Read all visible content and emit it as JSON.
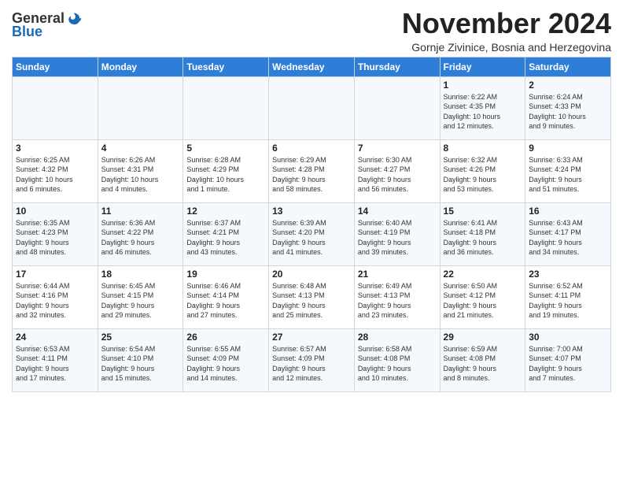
{
  "header": {
    "logo_general": "General",
    "logo_blue": "Blue",
    "month_title": "November 2024",
    "subtitle": "Gornje Zivinice, Bosnia and Herzegovina"
  },
  "weekdays": [
    "Sunday",
    "Monday",
    "Tuesday",
    "Wednesday",
    "Thursday",
    "Friday",
    "Saturday"
  ],
  "weeks": [
    [
      {
        "day": "",
        "info": ""
      },
      {
        "day": "",
        "info": ""
      },
      {
        "day": "",
        "info": ""
      },
      {
        "day": "",
        "info": ""
      },
      {
        "day": "",
        "info": ""
      },
      {
        "day": "1",
        "info": "Sunrise: 6:22 AM\nSunset: 4:35 PM\nDaylight: 10 hours\nand 12 minutes."
      },
      {
        "day": "2",
        "info": "Sunrise: 6:24 AM\nSunset: 4:33 PM\nDaylight: 10 hours\nand 9 minutes."
      }
    ],
    [
      {
        "day": "3",
        "info": "Sunrise: 6:25 AM\nSunset: 4:32 PM\nDaylight: 10 hours\nand 6 minutes."
      },
      {
        "day": "4",
        "info": "Sunrise: 6:26 AM\nSunset: 4:31 PM\nDaylight: 10 hours\nand 4 minutes."
      },
      {
        "day": "5",
        "info": "Sunrise: 6:28 AM\nSunset: 4:29 PM\nDaylight: 10 hours\nand 1 minute."
      },
      {
        "day": "6",
        "info": "Sunrise: 6:29 AM\nSunset: 4:28 PM\nDaylight: 9 hours\nand 58 minutes."
      },
      {
        "day": "7",
        "info": "Sunrise: 6:30 AM\nSunset: 4:27 PM\nDaylight: 9 hours\nand 56 minutes."
      },
      {
        "day": "8",
        "info": "Sunrise: 6:32 AM\nSunset: 4:26 PM\nDaylight: 9 hours\nand 53 minutes."
      },
      {
        "day": "9",
        "info": "Sunrise: 6:33 AM\nSunset: 4:24 PM\nDaylight: 9 hours\nand 51 minutes."
      }
    ],
    [
      {
        "day": "10",
        "info": "Sunrise: 6:35 AM\nSunset: 4:23 PM\nDaylight: 9 hours\nand 48 minutes."
      },
      {
        "day": "11",
        "info": "Sunrise: 6:36 AM\nSunset: 4:22 PM\nDaylight: 9 hours\nand 46 minutes."
      },
      {
        "day": "12",
        "info": "Sunrise: 6:37 AM\nSunset: 4:21 PM\nDaylight: 9 hours\nand 43 minutes."
      },
      {
        "day": "13",
        "info": "Sunrise: 6:39 AM\nSunset: 4:20 PM\nDaylight: 9 hours\nand 41 minutes."
      },
      {
        "day": "14",
        "info": "Sunrise: 6:40 AM\nSunset: 4:19 PM\nDaylight: 9 hours\nand 39 minutes."
      },
      {
        "day": "15",
        "info": "Sunrise: 6:41 AM\nSunset: 4:18 PM\nDaylight: 9 hours\nand 36 minutes."
      },
      {
        "day": "16",
        "info": "Sunrise: 6:43 AM\nSunset: 4:17 PM\nDaylight: 9 hours\nand 34 minutes."
      }
    ],
    [
      {
        "day": "17",
        "info": "Sunrise: 6:44 AM\nSunset: 4:16 PM\nDaylight: 9 hours\nand 32 minutes."
      },
      {
        "day": "18",
        "info": "Sunrise: 6:45 AM\nSunset: 4:15 PM\nDaylight: 9 hours\nand 29 minutes."
      },
      {
        "day": "19",
        "info": "Sunrise: 6:46 AM\nSunset: 4:14 PM\nDaylight: 9 hours\nand 27 minutes."
      },
      {
        "day": "20",
        "info": "Sunrise: 6:48 AM\nSunset: 4:13 PM\nDaylight: 9 hours\nand 25 minutes."
      },
      {
        "day": "21",
        "info": "Sunrise: 6:49 AM\nSunset: 4:13 PM\nDaylight: 9 hours\nand 23 minutes."
      },
      {
        "day": "22",
        "info": "Sunrise: 6:50 AM\nSunset: 4:12 PM\nDaylight: 9 hours\nand 21 minutes."
      },
      {
        "day": "23",
        "info": "Sunrise: 6:52 AM\nSunset: 4:11 PM\nDaylight: 9 hours\nand 19 minutes."
      }
    ],
    [
      {
        "day": "24",
        "info": "Sunrise: 6:53 AM\nSunset: 4:11 PM\nDaylight: 9 hours\nand 17 minutes."
      },
      {
        "day": "25",
        "info": "Sunrise: 6:54 AM\nSunset: 4:10 PM\nDaylight: 9 hours\nand 15 minutes."
      },
      {
        "day": "26",
        "info": "Sunrise: 6:55 AM\nSunset: 4:09 PM\nDaylight: 9 hours\nand 14 minutes."
      },
      {
        "day": "27",
        "info": "Sunrise: 6:57 AM\nSunset: 4:09 PM\nDaylight: 9 hours\nand 12 minutes."
      },
      {
        "day": "28",
        "info": "Sunrise: 6:58 AM\nSunset: 4:08 PM\nDaylight: 9 hours\nand 10 minutes."
      },
      {
        "day": "29",
        "info": "Sunrise: 6:59 AM\nSunset: 4:08 PM\nDaylight: 9 hours\nand 8 minutes."
      },
      {
        "day": "30",
        "info": "Sunrise: 7:00 AM\nSunset: 4:07 PM\nDaylight: 9 hours\nand 7 minutes."
      }
    ]
  ]
}
